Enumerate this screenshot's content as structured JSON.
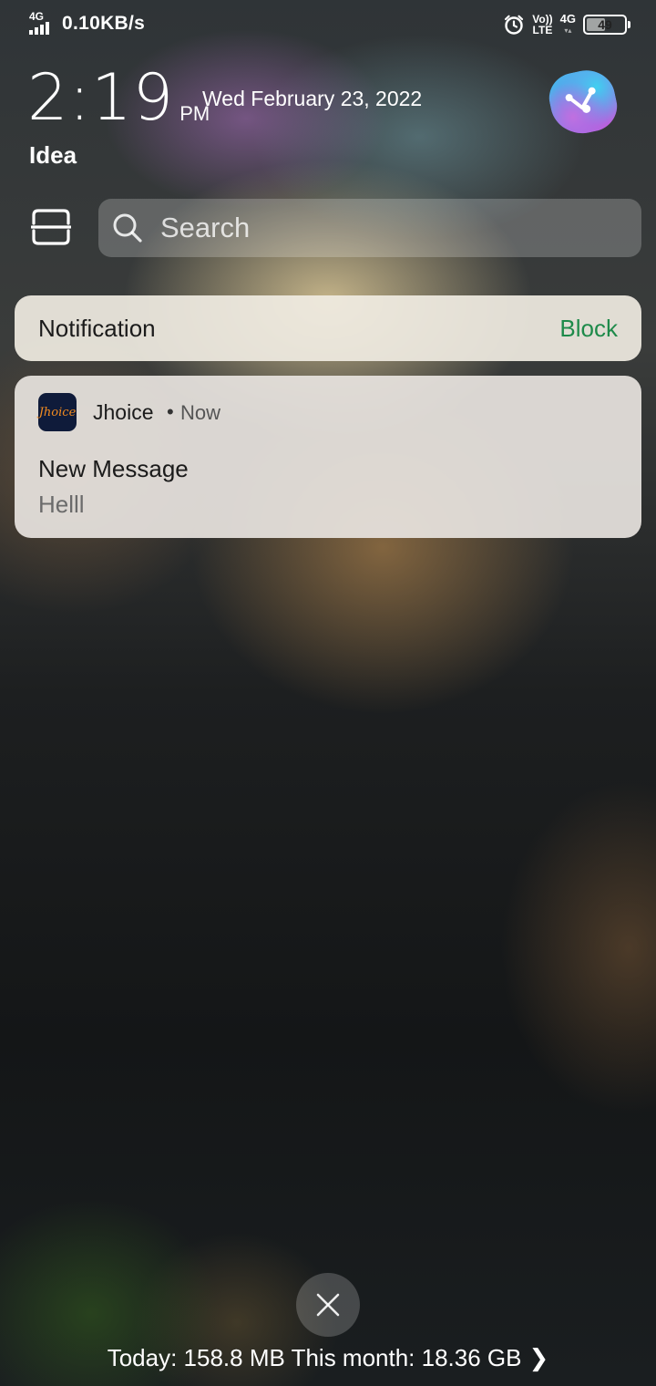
{
  "status_bar": {
    "network_type": "4G",
    "data_speed": "0.10KB/s",
    "volte_top": "Vo))",
    "volte_bottom": "LTE",
    "network_right": "4G",
    "battery_level": "49",
    "battery_fraction": 0.49
  },
  "lockscreen": {
    "time": "2:19",
    "ampm": "PM",
    "date": "Wed February 23, 2022",
    "carrier": "Idea"
  },
  "search": {
    "placeholder": "Search"
  },
  "notification_header": {
    "title": "Notification",
    "block_label": "Block"
  },
  "notification": {
    "app_icon_text": "Jhoice",
    "app_name": "Jhoice",
    "separator": "•",
    "time": "Now",
    "title": "New Message",
    "body": "Helll"
  },
  "footer": {
    "usage_text": "Today: 158.8 MB This month: 18.36 GB",
    "chevron": "❯"
  },
  "colors": {
    "block_accent": "#1e8a4a",
    "app_icon_bg": "#0f1b3a",
    "app_icon_text": "#f28b20"
  }
}
